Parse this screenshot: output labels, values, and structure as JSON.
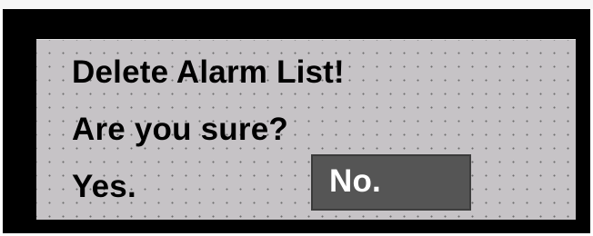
{
  "dialog": {
    "title": "Delete Alarm List!",
    "question": "Are you sure?",
    "buttons": {
      "yes_label": "Yes.",
      "no_label": "No."
    }
  },
  "colors": {
    "bezel": "#000000",
    "panel": "#c6c3c6",
    "selected_button": "#555555",
    "selected_text": "#ffffff",
    "text": "#000000"
  }
}
